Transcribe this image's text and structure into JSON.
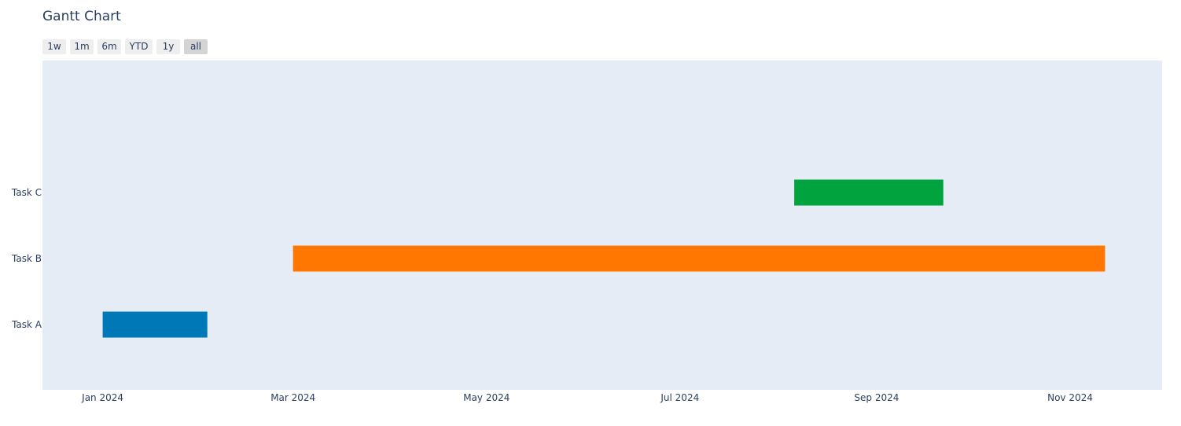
{
  "chart_data": {
    "type": "gantt",
    "title": "Gantt Chart",
    "tasks": [
      {
        "name": "Task A",
        "start": "2024-01-01",
        "end": "2024-02-03",
        "color": "#0077b6"
      },
      {
        "name": "Task B",
        "start": "2024-03-01",
        "end": "2024-11-12",
        "color": "#ff7700"
      },
      {
        "name": "Task C",
        "start": "2024-08-06",
        "end": "2024-09-22",
        "color": "#00a33d"
      }
    ],
    "x_ticks": [
      {
        "date": "2024-01-01",
        "label": "Jan 2024"
      },
      {
        "date": "2024-03-01",
        "label": "Mar 2024"
      },
      {
        "date": "2024-05-01",
        "label": "May 2024"
      },
      {
        "date": "2024-07-01",
        "label": "Jul 2024"
      },
      {
        "date": "2024-09-01",
        "label": "Sep 2024"
      },
      {
        "date": "2024-11-01",
        "label": "Nov 2024"
      }
    ],
    "y_categories": [
      "Task A",
      "Task B",
      "Task C"
    ],
    "xlim": [
      "2023-12-13",
      "2024-11-30"
    ],
    "plot_background": "#e5ecf6",
    "grid": false
  },
  "range_selector": {
    "buttons": [
      {
        "label": "1w",
        "active": false
      },
      {
        "label": "1m",
        "active": false
      },
      {
        "label": "6m",
        "active": false
      },
      {
        "label": "YTD",
        "active": false
      },
      {
        "label": "1y",
        "active": false
      },
      {
        "label": "all",
        "active": true
      }
    ]
  }
}
